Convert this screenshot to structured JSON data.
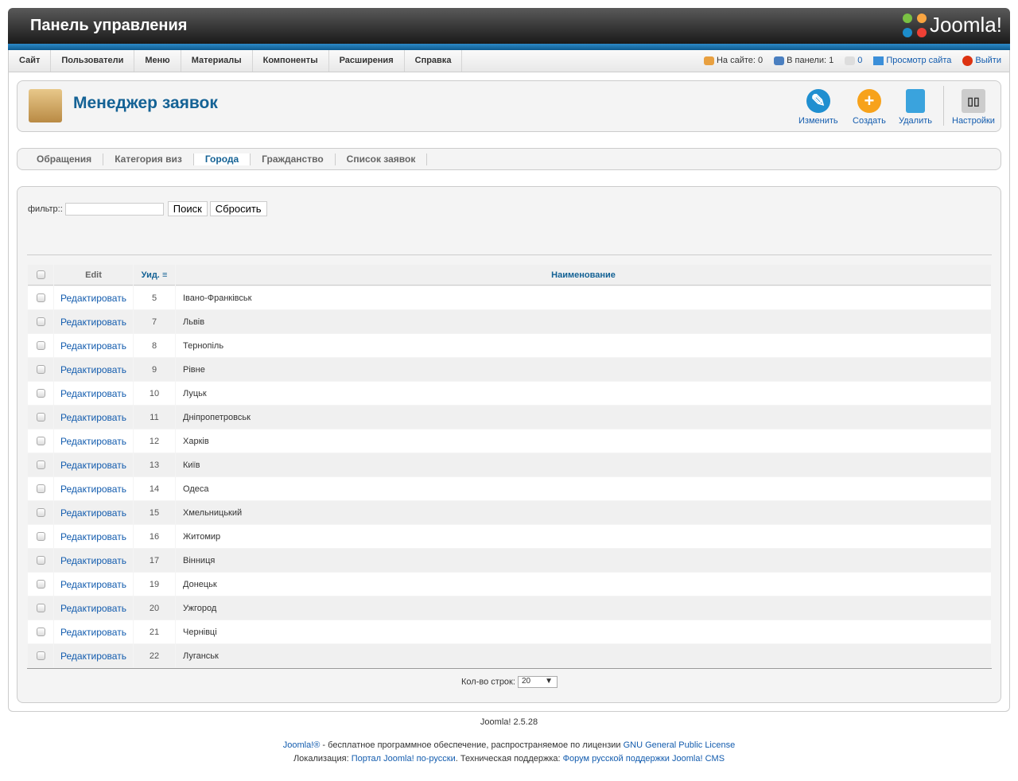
{
  "header": {
    "title": "Панель управления",
    "logo": "Joomla!"
  },
  "menu": [
    "Сайт",
    "Пользователи",
    "Меню",
    "Материалы",
    "Компоненты",
    "Расширения",
    "Справка"
  ],
  "status": {
    "online": "На сайте: 0",
    "admin": "В панели: 1",
    "messages": "0",
    "view_site": "Просмотр сайта",
    "logout": "Выйти"
  },
  "toolbar": {
    "title": "Менеджер заявок",
    "edit": "Изменить",
    "new": "Создать",
    "delete": "Удалить",
    "options": "Настройки"
  },
  "submenu": [
    "Обращения",
    "Категория виз",
    "Города",
    "Гражданство",
    "Список заявок"
  ],
  "filter": {
    "label": "фильтр::",
    "value": "",
    "search": "Поиск",
    "reset": "Сбросить"
  },
  "table": {
    "headers": {
      "edit": "Edit",
      "id": "Уид.",
      "name": "Наименование"
    },
    "edit_label": "Редактировать",
    "rows": [
      [
        5,
        "Івано-Франківськ"
      ],
      [
        7,
        "Львів"
      ],
      [
        8,
        "Тернопіль"
      ],
      [
        9,
        "Рівне"
      ],
      [
        10,
        "Луцьк"
      ],
      [
        11,
        "Дніпропетровськ"
      ],
      [
        12,
        "Харків"
      ],
      [
        13,
        "Київ"
      ],
      [
        14,
        "Одеса"
      ],
      [
        15,
        "Хмельницький"
      ],
      [
        16,
        "Житомир"
      ],
      [
        17,
        "Вінниця"
      ],
      [
        19,
        "Донецьк"
      ],
      [
        20,
        "Ужгород"
      ],
      [
        21,
        "Чернівці"
      ],
      [
        22,
        "Луганськ"
      ]
    ]
  },
  "pagination": {
    "label": "Кол-во строк:",
    "value": "20"
  },
  "footer": {
    "version": "Joomla! 2.5.28",
    "joomla_link": "Joomla!®",
    "text1": " - бесплатное программное обеспечение, распространяемое по лицензии ",
    "gpl": "GNU General Public License",
    "loc": "Локализация: ",
    "portal": "Портал Joomla! по-русски",
    "support": ". Техническая поддержка: ",
    "forum": "Форум русской поддержки Joomla! CMS"
  }
}
